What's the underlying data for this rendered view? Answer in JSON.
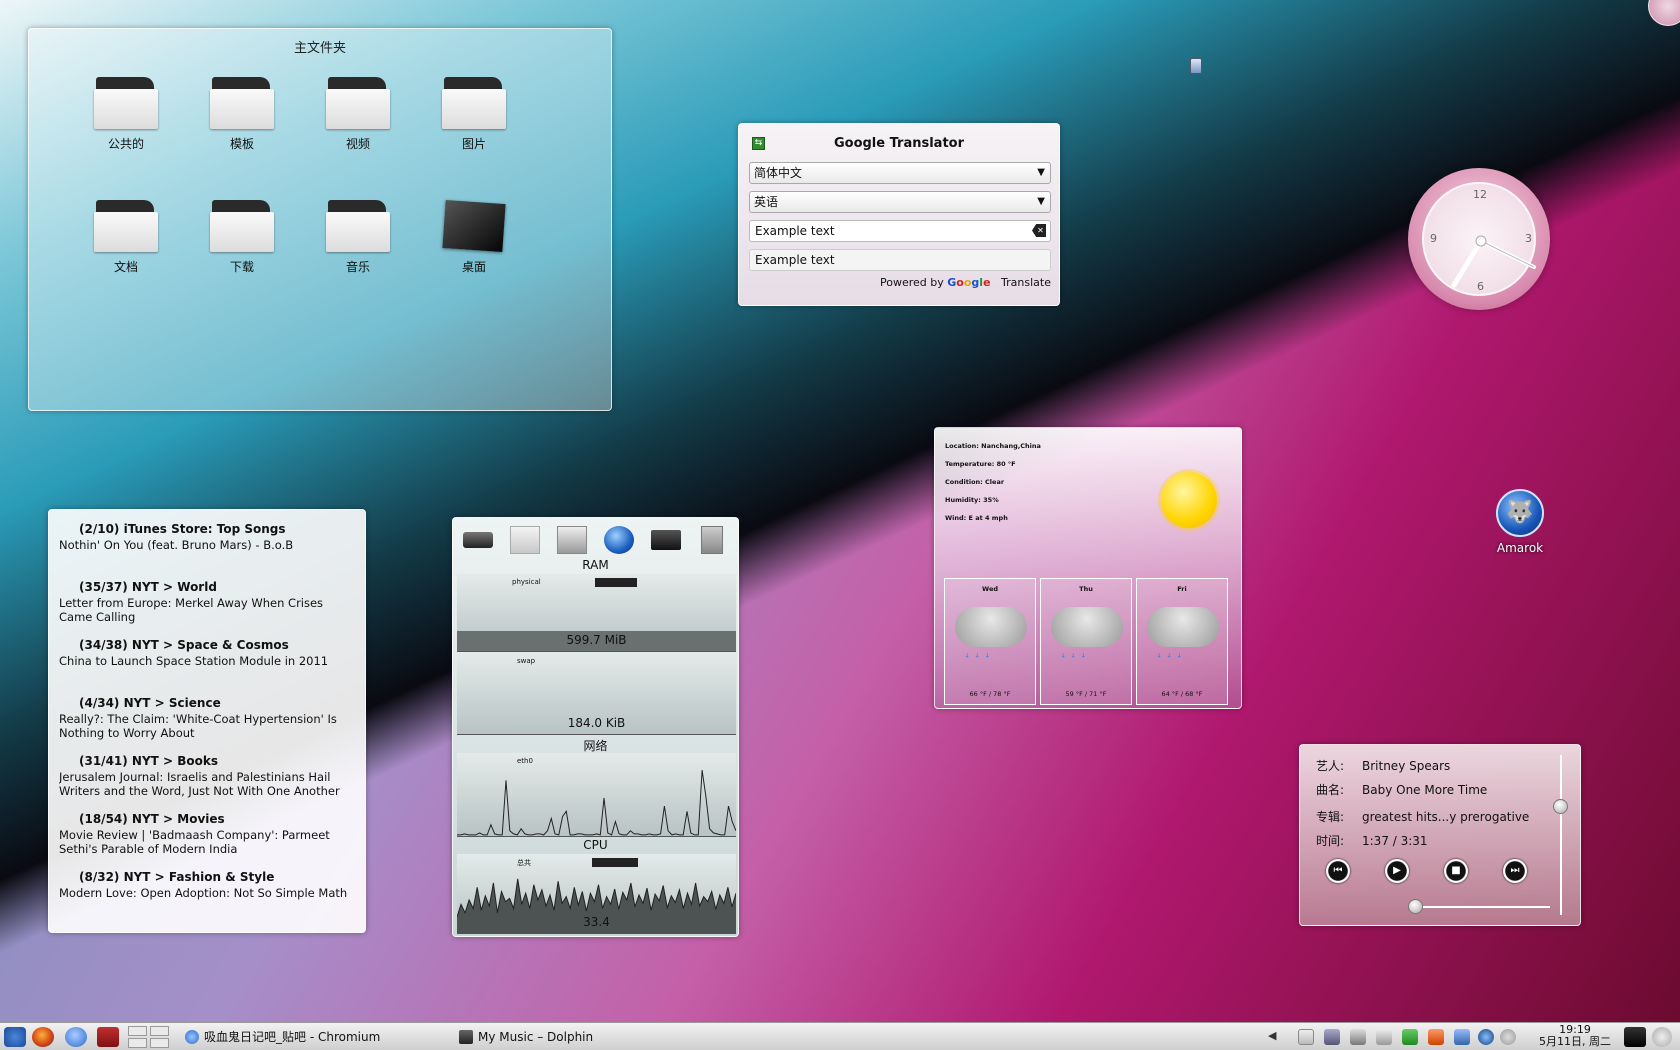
{
  "folderview": {
    "title": "主文件夹",
    "items": [
      {
        "label": "公共的"
      },
      {
        "label": "模板"
      },
      {
        "label": "视频"
      },
      {
        "label": "图片"
      },
      {
        "label": "文档"
      },
      {
        "label": "下载"
      },
      {
        "label": "音乐"
      },
      {
        "label": "桌面"
      }
    ]
  },
  "translator": {
    "title": "Google Translator",
    "from_lang": "简体中文",
    "to_lang": "英语",
    "input_value": "Example text",
    "output_value": "Example text",
    "powered_by": "Powered by",
    "google": [
      "G",
      "o",
      "o",
      "g",
      "l",
      "e"
    ],
    "translate_link": "Translate"
  },
  "clock": {
    "n12": "12",
    "n3": "3",
    "n6": "6",
    "n9": "9",
    "time": "19:19"
  },
  "weather": {
    "location": "Location: Nanchang,China",
    "temperature": "Temperature: 80 °F",
    "condition": "Condition: Clear",
    "humidity": "Humidity: 35%",
    "wind": "Wind: E at 4 mph",
    "forecast": [
      {
        "day": "Wed",
        "temps": "66 °F / 78 °F"
      },
      {
        "day": "Thu",
        "temps": "59 °F / 71 °F"
      },
      {
        "day": "Fri",
        "temps": "64 °F / 68 °F"
      }
    ]
  },
  "amarok": {
    "label": "Amarok"
  },
  "news": {
    "items": [
      {
        "head": "(2/10) iTunes Store: Top Songs",
        "body": "Nothin' On You (feat. Bruno Mars) - B.o.B"
      },
      {
        "head": "(35/37) NYT > World",
        "body": "Letter from Europe: Merkel Away When Crises Came Calling"
      },
      {
        "head": "(34/38) NYT > Space & Cosmos",
        "body": "China to Launch Space Station Module in 2011"
      },
      {
        "head": "(4/34) NYT > Science",
        "body": "Really?: The Claim: 'White-Coat Hypertension' Is Nothing to Worry About"
      },
      {
        "head": "(31/41) NYT > Books",
        "body": "Jerusalem Journal: Israelis and Palestinians Hail Writers and the Word, Just Not With One Another"
      },
      {
        "head": "(18/54) NYT > Movies",
        "body": "Movie Review | 'Badmaash Company': Parmeet Sethi's Parable of Modern India"
      },
      {
        "head": "(8/32) NYT > Fashion & Style",
        "body": "Modern Love: Open Adoption: Not So Simple Math"
      }
    ]
  },
  "sysmon": {
    "ram_title": "RAM",
    "physical_label": "physical",
    "physical_value": "599.7 MiB",
    "swap_label": "swap",
    "swap_value": "184.0 KiB",
    "net_title": "网络",
    "net_label": "eth0",
    "cpu_title": "CPU",
    "cpu_label": "总共",
    "cpu_value": "33.4",
    "net_series": [
      2,
      2,
      3,
      2,
      2,
      2,
      4,
      2,
      2,
      12,
      3,
      2,
      2,
      55,
      6,
      3,
      2,
      8,
      3,
      2,
      2,
      3,
      3,
      2,
      6,
      18,
      3,
      2,
      20,
      25,
      2,
      2,
      3,
      3,
      2,
      2,
      2,
      3,
      2,
      38,
      4,
      2,
      15,
      3,
      2,
      2,
      6,
      3,
      3,
      2,
      2,
      3,
      2,
      2,
      3,
      30,
      6,
      2,
      3,
      2,
      2,
      25,
      4,
      2,
      2,
      65,
      40,
      8,
      4,
      3,
      2,
      2,
      30,
      15,
      6
    ],
    "cpu_series": [
      20,
      35,
      25,
      40,
      30,
      55,
      28,
      45,
      33,
      60,
      25,
      50,
      38,
      42,
      30,
      65,
      35,
      48,
      30,
      58,
      40,
      52,
      33,
      46,
      28,
      62,
      36,
      44,
      30,
      55,
      34,
      50,
      27,
      48,
      38,
      58,
      30,
      44,
      35,
      53,
      29,
      49,
      40,
      60,
      32,
      46,
      36,
      54,
      28,
      47,
      39,
      57,
      31,
      45,
      37,
      52,
      30,
      48,
      35,
      60,
      33,
      44,
      38,
      50,
      29,
      46,
      36,
      55,
      32,
      48
    ]
  },
  "player": {
    "artist_label": "艺人:",
    "artist": "Britney Spears",
    "title_label": "曲名:",
    "title": "Baby One More Time",
    "album_label": "专辑:",
    "album": "greatest hits...y prerogative",
    "time_label": "时间:",
    "time": "1:37 / 3:31",
    "progress": 0.03,
    "volume": 0.68
  },
  "taskbar": {
    "tasks": [
      {
        "label": "吸血鬼日记吧_贴吧 - Chromium"
      },
      {
        "label": "My Music – Dolphin"
      }
    ],
    "clock_time": "19:19",
    "clock_date": "5月11日, 周二"
  },
  "colors": {
    "accent": "#b0186e",
    "sky": "#2a9bb8"
  }
}
